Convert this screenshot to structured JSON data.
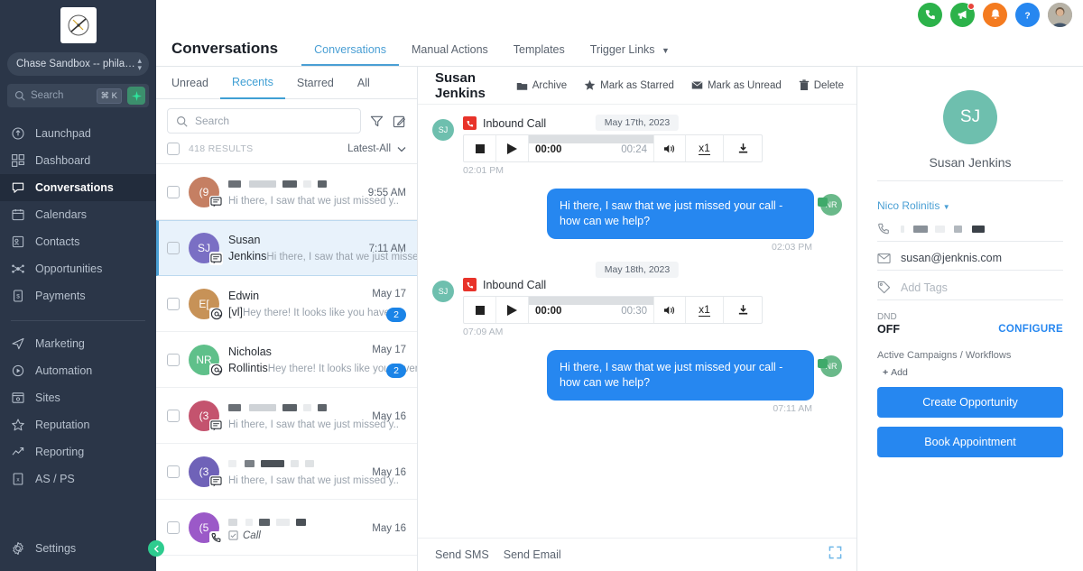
{
  "sidebar": {
    "logo_icon": "compass-logo",
    "workspace": {
      "label": "Chase Sandbox -- philad...",
      "switch_icon": "up-down-chevron-icon"
    },
    "search": {
      "placeholder": "Search",
      "shortcut": "⌘ K",
      "ai_icon": "sparkle-icon"
    },
    "items": [
      {
        "label": "Launchpad",
        "icon": "rocket-icon",
        "active": false
      },
      {
        "label": "Dashboard",
        "icon": "grid-icon",
        "active": false
      },
      {
        "label": "Conversations",
        "icon": "chat-bubble-icon",
        "active": true
      },
      {
        "label": "Calendars",
        "icon": "calendar-icon",
        "active": false
      },
      {
        "label": "Contacts",
        "icon": "contact-card-icon",
        "active": false
      },
      {
        "label": "Opportunities",
        "icon": "opportunities-icon",
        "active": false
      },
      {
        "label": "Payments",
        "icon": "payments-icon",
        "active": false
      }
    ],
    "items2": [
      {
        "label": "Marketing",
        "icon": "paper-plane-icon"
      },
      {
        "label": "Automation",
        "icon": "play-circle-icon"
      },
      {
        "label": "Sites",
        "icon": "browser-window-icon"
      },
      {
        "label": "Reputation",
        "icon": "star-icon"
      },
      {
        "label": "Reporting",
        "icon": "trend-up-icon"
      },
      {
        "label": "AS / PS",
        "icon": "spreadsheet-icon"
      }
    ],
    "settings": {
      "label": "Settings",
      "icon": "gear-icon"
    },
    "collapse_icon": "chevron-left-icon"
  },
  "topbar": {
    "icons": [
      {
        "name": "phone-icon",
        "color": "#2cb24a"
      },
      {
        "name": "megaphone-icon",
        "color": "#2cb24a",
        "dot": true
      },
      {
        "name": "bell-icon",
        "color": "#f47b20"
      },
      {
        "name": "help-icon",
        "color": "#2687f0"
      }
    ],
    "avatar": "user-avatar"
  },
  "header": {
    "title": "Conversations",
    "tabs": [
      {
        "label": "Conversations",
        "active": true,
        "dropdown": false
      },
      {
        "label": "Manual Actions",
        "active": false,
        "dropdown": false
      },
      {
        "label": "Templates",
        "active": false,
        "dropdown": false
      },
      {
        "label": "Trigger Links",
        "active": false,
        "dropdown": true
      }
    ]
  },
  "convlist": {
    "filters": [
      {
        "label": "Unread",
        "active": false
      },
      {
        "label": "Recents",
        "active": true
      },
      {
        "label": "Starred",
        "active": false
      },
      {
        "label": "All",
        "active": false
      }
    ],
    "search_placeholder": "Search",
    "filter_icon": "funnel-icon",
    "compose_icon": "compose-pencil-icon",
    "results_count": "418 RESULTS",
    "sort_label": "Latest-All",
    "rows": [
      {
        "name": "",
        "redacted": true,
        "preview": "Hi there, I saw that we just missed y..",
        "time": "9:55 AM",
        "initials": "(9",
        "color": "#c57f63",
        "badge_icon": "message-icon",
        "unread": null,
        "selected": false
      },
      {
        "name": "Susan Jenkins",
        "redacted": false,
        "preview": "Hi there, I saw that we just missed y..",
        "time": "7:11 AM",
        "initials": "SJ",
        "color": "#7a6fc4",
        "badge_icon": "message-icon",
        "unread": null,
        "selected": true
      },
      {
        "name": "Edwin [vl]",
        "redacted": false,
        "preview": "Hey there!  It looks like you haven'..",
        "time": "May 17",
        "initials": "E[",
        "color": "#c79257",
        "badge_icon": "at-icon",
        "unread": "2",
        "selected": false
      },
      {
        "name": "Nicholas Rollintis",
        "redacted": false,
        "preview": "Hey there!  It looks like you haven'..",
        "time": "May 17",
        "initials": "NR",
        "color": "#5fc08a",
        "badge_icon": "at-icon",
        "unread": "2",
        "selected": false
      },
      {
        "name": "",
        "redacted": true,
        "preview": "Hi there, I saw that we just missed y..",
        "time": "May 16",
        "initials": "(3",
        "color": "#c4536e",
        "badge_icon": "message-icon",
        "unread": null,
        "selected": false
      },
      {
        "name": "",
        "redacted": true,
        "preview": "Hi there, I saw that we just missed y..",
        "time": "May 16",
        "initials": "(3",
        "color": "#6f62b8",
        "badge_icon": "message-icon",
        "unread": null,
        "selected": false
      },
      {
        "name": "",
        "redacted": true,
        "preview": "Call",
        "time": "May 16",
        "initials": "(5",
        "color": "#9b59c8",
        "badge_icon": "phone-icon",
        "unread": null,
        "selected": false,
        "is_call": true
      }
    ]
  },
  "thread": {
    "title": "Susan Jenkins",
    "actions": [
      {
        "label": "Archive",
        "icon": "archive-icon"
      },
      {
        "label": "Mark as Starred",
        "icon": "star-filled-icon"
      },
      {
        "label": "Mark as Unread",
        "icon": "envelope-icon"
      },
      {
        "label": "Delete",
        "icon": "trash-icon"
      }
    ],
    "groups": [
      {
        "date_pill": "May 17th, 2023",
        "call": {
          "label": "Inbound Call",
          "icon": "inbound-call-icon",
          "avatar_initials": "SJ",
          "current_time": "00:00",
          "total_time": "00:24",
          "timestamp": "02:01 PM",
          "stop_icon": "stop-icon",
          "play_icon": "play-icon",
          "volume_icon": "volume-icon",
          "speed_label": "x1",
          "download_icon": "download-icon"
        },
        "reply": {
          "text": "Hi there, I saw that we just missed your call - how can we help?",
          "timestamp": "02:03 PM",
          "avatar_initials": "NR"
        }
      },
      {
        "date_pill": "May 18th, 2023",
        "call": {
          "label": "Inbound Call",
          "icon": "inbound-call-icon",
          "avatar_initials": "SJ",
          "current_time": "00:00",
          "total_time": "00:30",
          "timestamp": "07:09 AM",
          "stop_icon": "stop-icon",
          "play_icon": "play-icon",
          "volume_icon": "volume-icon",
          "speed_label": "x1",
          "download_icon": "download-icon"
        },
        "reply": {
          "text": "Hi there, I saw that we just missed your call - how can we help?",
          "timestamp": "07:11 AM",
          "avatar_initials": "NR"
        }
      }
    ],
    "composer": {
      "sms_label": "Send SMS",
      "email_label": "Send Email",
      "expand_icon": "expand-icon"
    }
  },
  "contact": {
    "avatar_initials": "SJ",
    "name": "Susan Jenkins",
    "owner": "Nico Rolinitis",
    "owner_icon": "caret-down-icon",
    "phone_icon": "phone-outline-icon",
    "phone_value": "",
    "email_icon": "envelope-outline-icon",
    "email_value": "susan@jenknis.com",
    "tag_icon": "tag-icon",
    "tags_placeholder": "Add Tags",
    "dnd_label": "DND",
    "dnd_value": "OFF",
    "configure_label": "CONFIGURE",
    "campaigns_label": "Active Campaigns / Workflows",
    "add_label": "Add",
    "create_opportunity_label": "Create Opportunity",
    "book_appointment_label": "Book Appointment"
  }
}
